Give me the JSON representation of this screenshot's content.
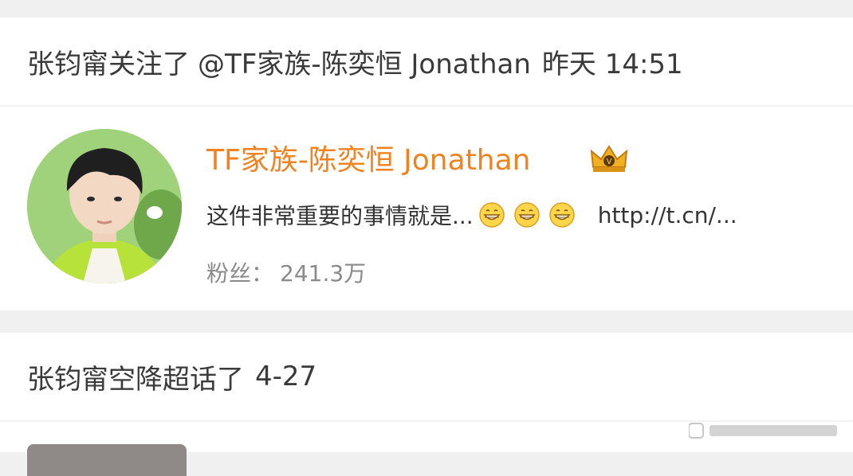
{
  "activity1": {
    "actor": "张钧甯",
    "action": "关注了",
    "mention": "@TF家族-陈奕恒 Jonathan",
    "time": "昨天 14:51"
  },
  "profile": {
    "name": "TF家族-陈奕恒 Jonathan",
    "badge_icon": "crown-icon",
    "bio_text": "这件非常重要的事情就是...",
    "bio_emojis": [
      "grin-icon",
      "grin-icon",
      "grin-icon"
    ],
    "bio_link": "http://t.cn/...",
    "fans_label": "粉丝：",
    "fans_count": "241.3万",
    "name_color": "#f08220"
  },
  "activity2": {
    "actor": "张钧甯",
    "action": "空降超话了",
    "date": "4-27"
  }
}
